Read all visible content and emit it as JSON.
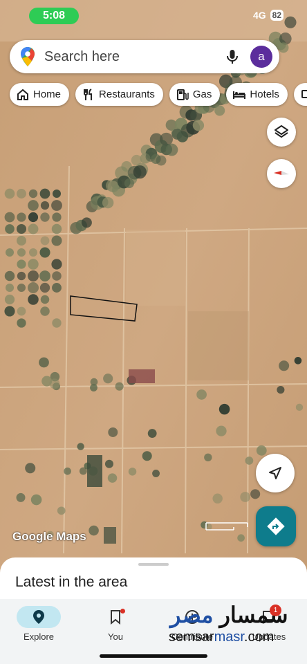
{
  "status": {
    "time": "5:08",
    "network": "4G",
    "battery": "82"
  },
  "search": {
    "placeholder": "Search here",
    "avatar_letter": "a"
  },
  "chips": [
    {
      "label": "Home",
      "icon": "home-icon"
    },
    {
      "label": "Restaurants",
      "icon": "restaurant-icon"
    },
    {
      "label": "Gas",
      "icon": "gas-station-icon"
    },
    {
      "label": "Hotels",
      "icon": "hotel-icon"
    }
  ],
  "map": {
    "watermark": "Google Maps"
  },
  "sheet": {
    "title": "Latest in the area"
  },
  "nav": {
    "items": [
      {
        "label": "Explore",
        "icon": "location-pin-icon",
        "active": true
      },
      {
        "label": "You",
        "icon": "bookmark-icon",
        "active": false
      },
      {
        "label": "Contribute",
        "icon": "add-circle-icon",
        "active": false
      },
      {
        "label": "Updates",
        "icon": "chat-bubble-icon",
        "active": false,
        "badge": "1"
      }
    ]
  },
  "overlay": {
    "brand_ar_dark": "سمسار ",
    "brand_ar_blue": "مصر",
    "brand_en_dark": "semsar",
    "brand_en_blue": "masr",
    "brand_en_tail": ".com"
  },
  "colors": {
    "accent": "#0e7c8c",
    "avatar": "#5b2d9c",
    "active_pill": "#c2e7f1"
  }
}
